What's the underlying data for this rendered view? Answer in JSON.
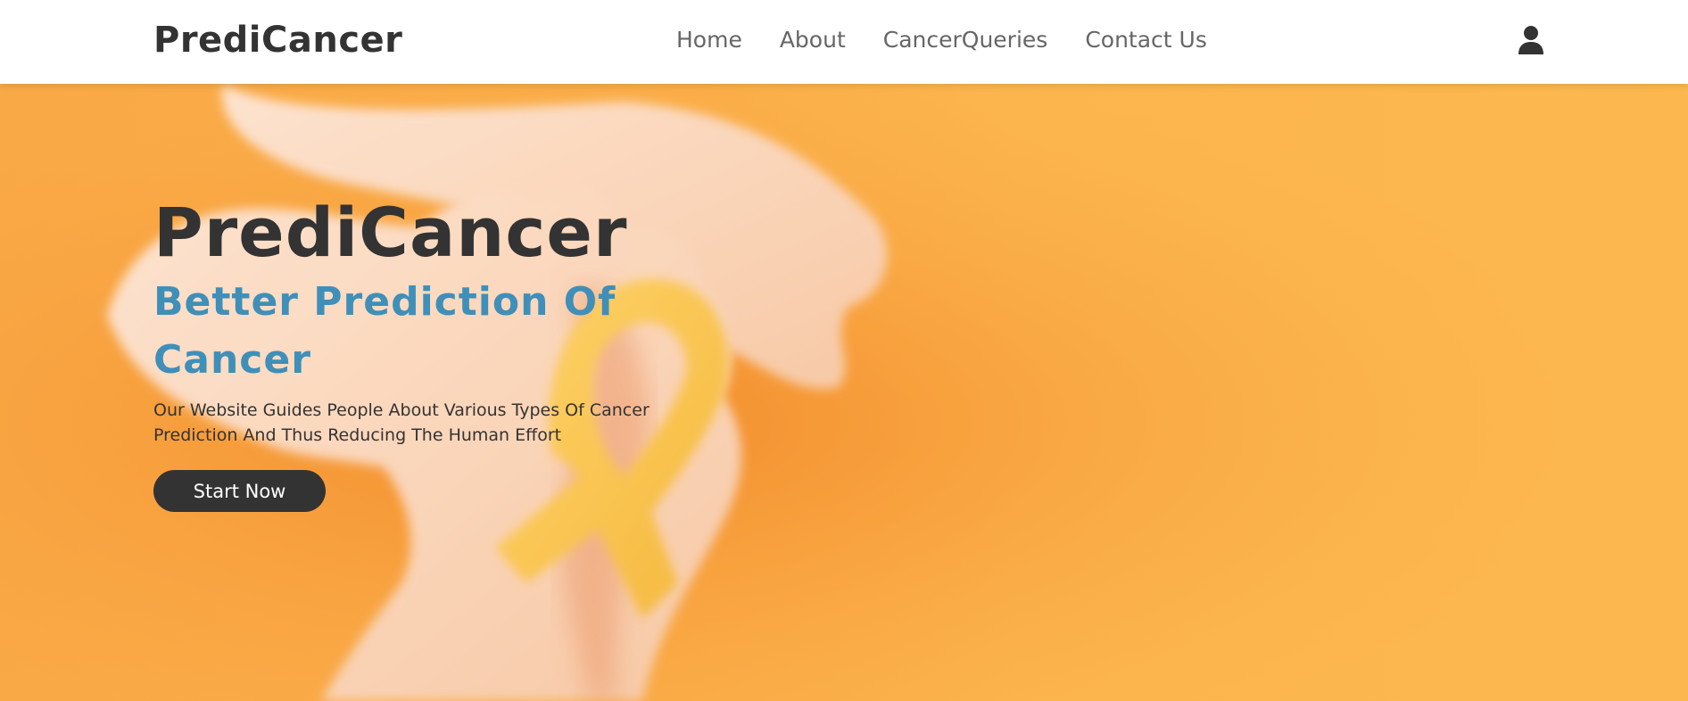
{
  "navbar": {
    "brand": "PrediCancer",
    "links": [
      {
        "label": "Home"
      },
      {
        "label": "About"
      },
      {
        "label": "CancerQueries"
      },
      {
        "label": "Contact Us"
      }
    ],
    "user_icon": "user-icon"
  },
  "hero": {
    "title": "PrediCancer",
    "subtitle": "Better Prediction Of Cancer",
    "description": "Our Website Guides People About Various Types Of Cancer Prediction And Thus Reducing The Human Effort",
    "cta_label": "Start Now",
    "background_image": "hands-holding-awareness-ribbon",
    "colors": {
      "background": "#fbb14b",
      "title": "#333333",
      "subtitle": "#3f8fb9",
      "button": "#333333"
    }
  }
}
